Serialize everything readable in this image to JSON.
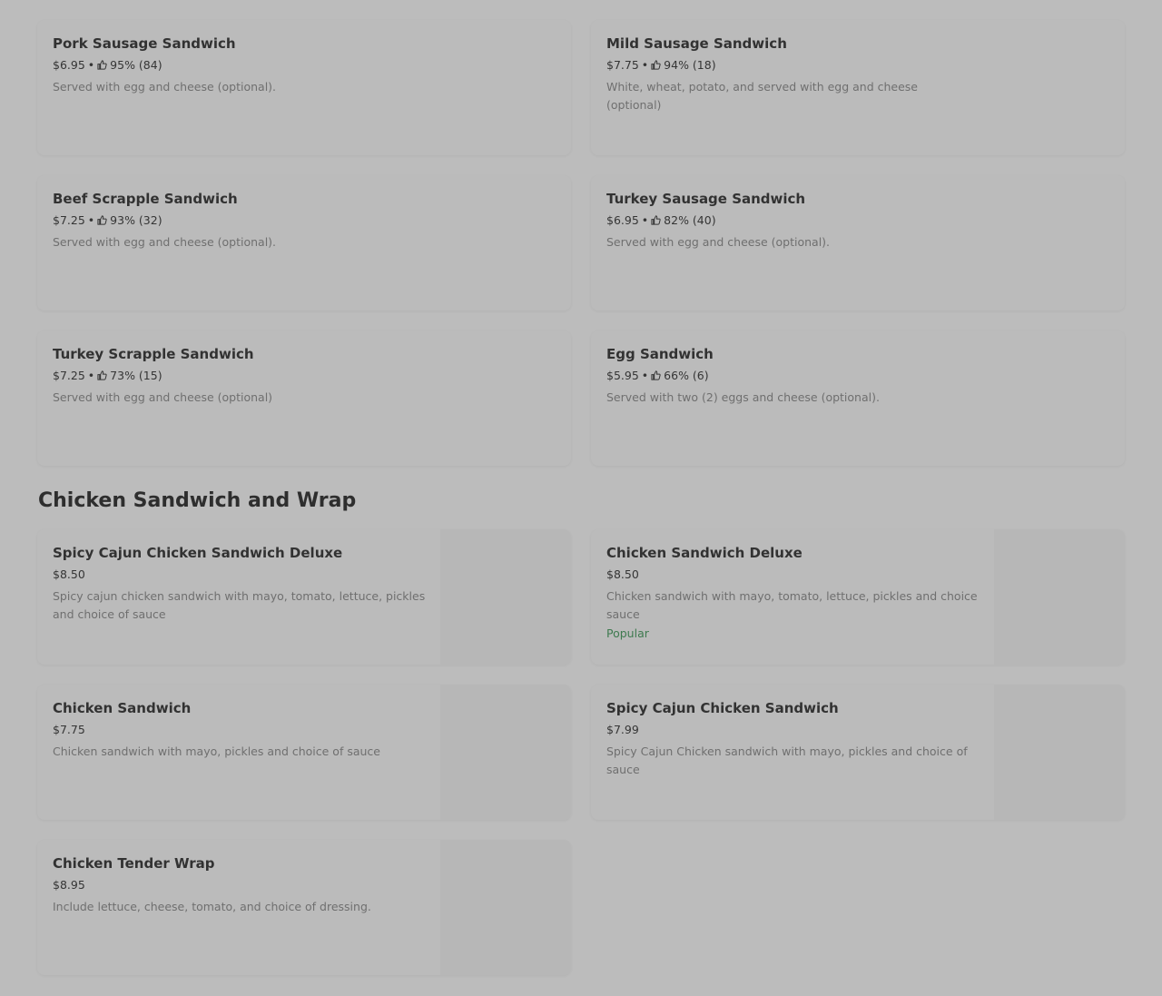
{
  "breakfast_items": [
    {
      "name": "Pork Sausage Sandwich",
      "price": "$6.95",
      "rating": "95% (84)",
      "description": "Served with egg and cheese (optional)."
    },
    {
      "name": "Mild Sausage Sandwich",
      "price": "$7.75",
      "rating": "94% (18)",
      "description": "White, wheat, potato, and served with egg and cheese (optional)"
    },
    {
      "name": "Beef Scrapple Sandwich",
      "price": "$7.25",
      "rating": "93% (32)",
      "description": "Served with egg and cheese (optional)."
    },
    {
      "name": "Turkey Sausage Sandwich",
      "price": "$6.95",
      "rating": "82% (40)",
      "description": "Served with egg and cheese (optional)."
    },
    {
      "name": "Turkey Scrapple Sandwich",
      "price": "$7.25",
      "rating": "73% (15)",
      "description": "Served with egg and cheese (optional)"
    },
    {
      "name": "Egg Sandwich",
      "price": "$5.95",
      "rating": "66% (6)",
      "description": "Served with two (2) eggs and cheese (optional)."
    }
  ],
  "chicken_section": {
    "title": "Chicken Sandwich and Wrap",
    "items": [
      {
        "name": "Spicy Cajun Chicken Sandwich Deluxe",
        "price": "$8.50",
        "description": "Spicy cajun chicken sandwich with mayo, tomato, lettuce, pickles and choice of sauce",
        "badge": ""
      },
      {
        "name": "Chicken Sandwich Deluxe",
        "price": "$8.50",
        "description": "Chicken sandwich with mayo, tomato, lettuce, pickles and choice sauce",
        "badge": "Popular"
      },
      {
        "name": "Chicken Sandwich",
        "price": "$7.75",
        "description": "Chicken sandwich with mayo, pickles and choice of sauce",
        "badge": ""
      },
      {
        "name": "Spicy Cajun Chicken Sandwich",
        "price": "$7.99",
        "description": "Spicy Cajun Chicken sandwich with mayo, pickles and choice of sauce",
        "badge": ""
      },
      {
        "name": "Chicken Tender Wrap",
        "price": "$8.95",
        "description": "Include lettuce, cheese, tomato, and choice of dressing.",
        "badge": ""
      }
    ]
  },
  "separator": "•",
  "icons": {
    "rating": "thumbs-up-icon"
  }
}
